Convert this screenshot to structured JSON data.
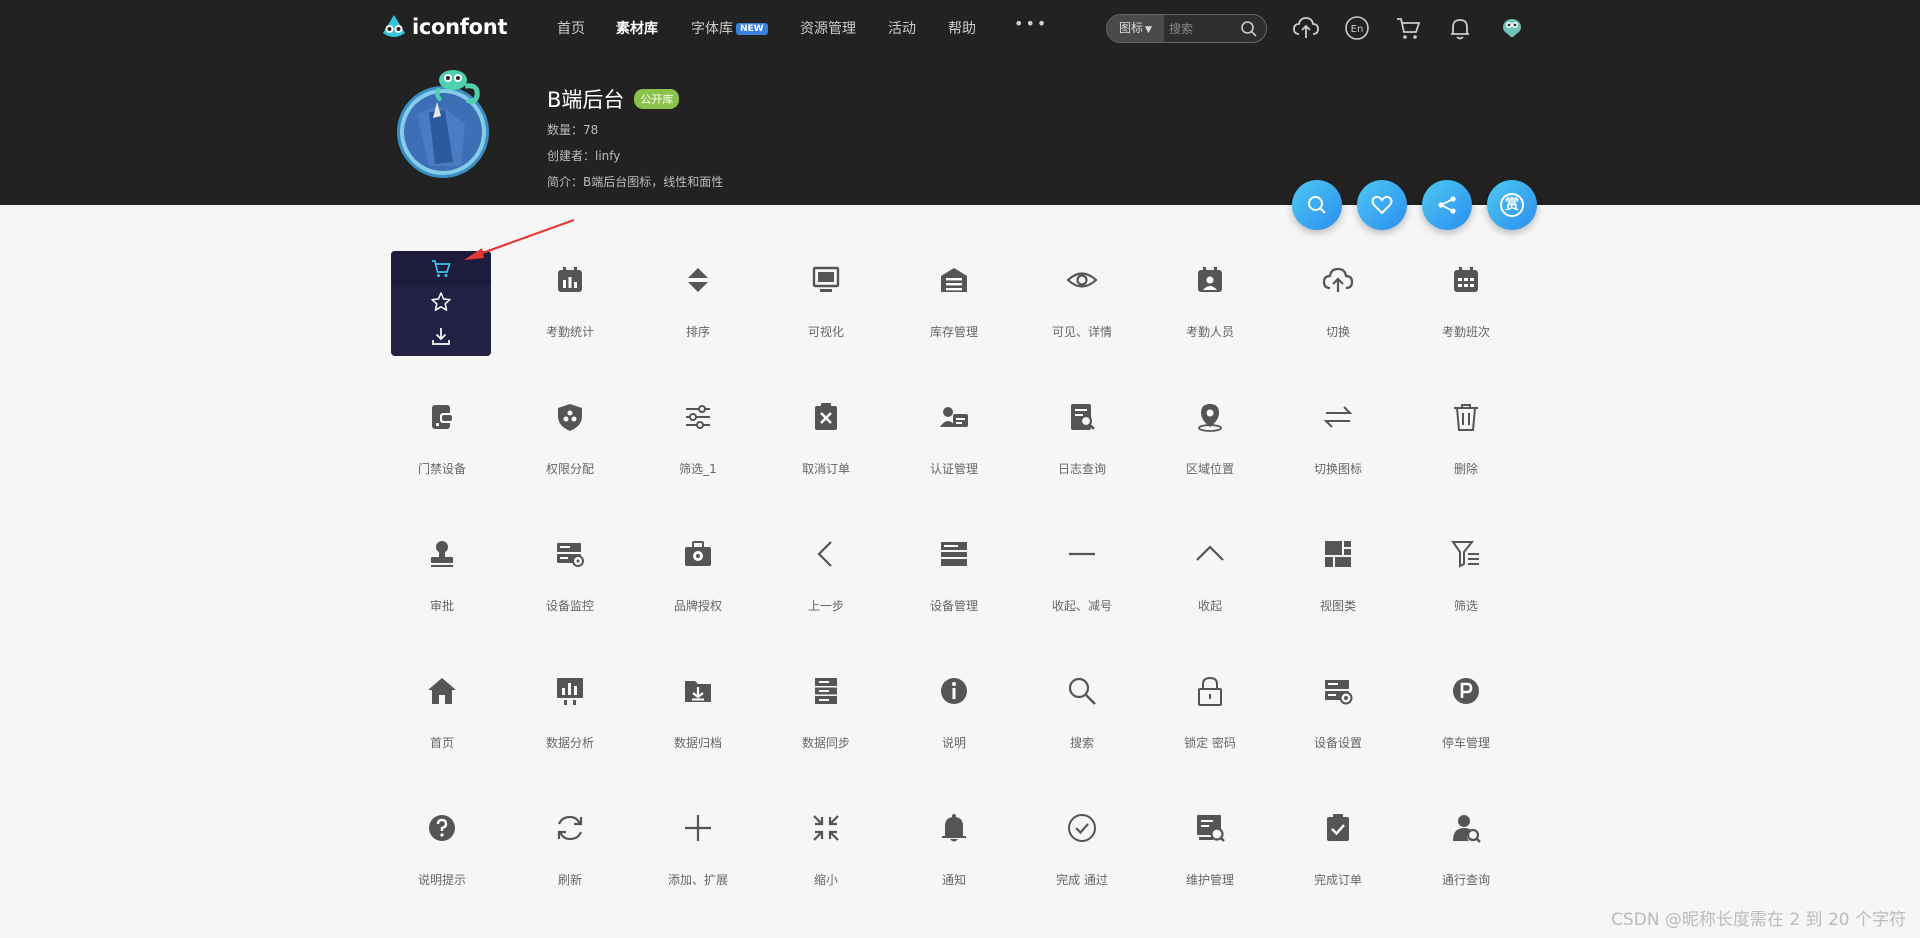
{
  "brand": {
    "name": "iconfont"
  },
  "nav": {
    "items": [
      {
        "label": "首页",
        "active": false
      },
      {
        "label": "素材库",
        "active": true
      },
      {
        "label": "字体库",
        "active": false,
        "badge": "NEW"
      },
      {
        "label": "资源管理",
        "active": false
      },
      {
        "label": "活动",
        "active": false
      },
      {
        "label": "帮助",
        "active": false
      }
    ],
    "more": "•••"
  },
  "search": {
    "type_label": "图标",
    "placeholder": "搜索"
  },
  "library": {
    "title": "B端后台",
    "badge": "公开库",
    "count_line": "数量：78",
    "creator_line": "创建者：linfy",
    "intro_line": "简介：B端后台图标，线性和面性"
  },
  "actions": {
    "reward_label": "赏"
  },
  "icons": [
    {
      "label": "",
      "icon": "cart-icon"
    },
    {
      "label": "考勤统计",
      "icon": "attendance-stats-icon"
    },
    {
      "label": "排序",
      "icon": "sort-icon"
    },
    {
      "label": "可视化",
      "icon": "monitor-icon"
    },
    {
      "label": "库存管理",
      "icon": "warehouse-icon"
    },
    {
      "label": "可见、详情",
      "icon": "eye-icon"
    },
    {
      "label": "考勤人员",
      "icon": "calendar-person-icon"
    },
    {
      "label": "切换",
      "icon": "cloud-upload-icon"
    },
    {
      "label": "考勤班次",
      "icon": "calendar-grid-icon"
    },
    {
      "label": "门禁设备",
      "icon": "access-device-icon"
    },
    {
      "label": "权限分配",
      "icon": "shield-icon"
    },
    {
      "label": "筛选_1",
      "icon": "sliders-icon"
    },
    {
      "label": "取消订单",
      "icon": "clipboard-x-icon"
    },
    {
      "label": "认证管理",
      "icon": "id-card-icon"
    },
    {
      "label": "日志查询",
      "icon": "log-search-icon"
    },
    {
      "label": "区域位置",
      "icon": "location-pin-icon"
    },
    {
      "label": "切换图标",
      "icon": "swap-arrows-icon"
    },
    {
      "label": "删除",
      "icon": "trash-icon"
    },
    {
      "label": "审批",
      "icon": "stamp-icon"
    },
    {
      "label": "设备监控",
      "icon": "device-monitor-icon"
    },
    {
      "label": "品牌授权",
      "icon": "briefcase-gear-icon"
    },
    {
      "label": "上一步",
      "icon": "chevron-left-icon"
    },
    {
      "label": "设备管理",
      "icon": "server-icon"
    },
    {
      "label": "收起、减号",
      "icon": "minus-icon"
    },
    {
      "label": "收起",
      "icon": "chevron-up-icon"
    },
    {
      "label": "视图类",
      "icon": "view-grid-icon"
    },
    {
      "label": "筛选",
      "icon": "filter-list-icon"
    },
    {
      "label": "首页",
      "icon": "home-icon"
    },
    {
      "label": "数据分析",
      "icon": "chart-board-icon"
    },
    {
      "label": "数据归档",
      "icon": "folder-download-icon"
    },
    {
      "label": "数据同步",
      "icon": "database-icon"
    },
    {
      "label": "说明",
      "icon": "info-icon"
    },
    {
      "label": "搜索",
      "icon": "search-icon"
    },
    {
      "label": "锁定 密码",
      "icon": "lock-icon"
    },
    {
      "label": "设备设置",
      "icon": "device-settings-icon"
    },
    {
      "label": "停车管理",
      "icon": "parking-icon"
    },
    {
      "label": "说明提示",
      "icon": "help-icon"
    },
    {
      "label": "刷新",
      "icon": "refresh-icon"
    },
    {
      "label": "添加、扩展",
      "icon": "plus-icon"
    },
    {
      "label": "缩小",
      "icon": "shrink-icon"
    },
    {
      "label": "通知",
      "icon": "bell-icon"
    },
    {
      "label": "完成 通过",
      "icon": "check-circle-icon"
    },
    {
      "label": "维护管理",
      "icon": "maintenance-icon"
    },
    {
      "label": "完成订单",
      "icon": "clipboard-check-icon"
    },
    {
      "label": "通行查询",
      "icon": "person-search-icon"
    }
  ],
  "watermark": "CSDN @昵称长度需在 2 到 20 个字符"
}
